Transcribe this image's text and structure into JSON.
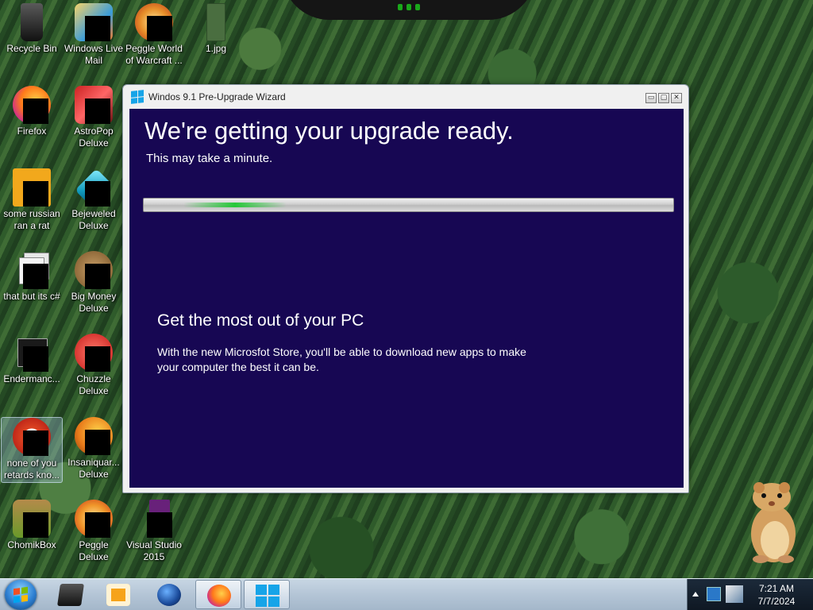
{
  "desktop": {
    "icons": [
      {
        "label": "Recycle Bin",
        "icon": "recycle-bin-icon"
      },
      {
        "label": "Windows Live Mail",
        "icon": "mail-icon"
      },
      {
        "label": "Peggle World of Warcraft ...",
        "icon": "peggle-wow-icon"
      },
      {
        "label": "1.jpg",
        "icon": "image-file-icon"
      },
      {
        "label": "Firefox",
        "icon": "firefox-icon"
      },
      {
        "label": "AstroPop Deluxe",
        "icon": "astropop-icon"
      },
      {
        "label": "some russian ran a rat",
        "icon": "app-icon"
      },
      {
        "label": "Bejeweled Deluxe",
        "icon": "bejeweled-icon"
      },
      {
        "label": "that but its c#",
        "icon": "stacked-windows-icon"
      },
      {
        "label": "Big Money Deluxe",
        "icon": "big-money-icon"
      },
      {
        "label": "Endermanc...",
        "icon": "terminal-icon"
      },
      {
        "label": "Chuzzle Deluxe",
        "icon": "chuzzle-icon"
      },
      {
        "label": "none of you retards kno...",
        "icon": "shortcut-icon"
      },
      {
        "label": "Insaniquar... Deluxe",
        "icon": "insaniquarium-icon"
      },
      {
        "label": "ChomikBox",
        "icon": "chomikbox-icon"
      },
      {
        "label": "Peggle Deluxe",
        "icon": "peggle-icon"
      },
      {
        "label": "Visual Studio 2015",
        "icon": "visual-studio-icon"
      }
    ]
  },
  "window": {
    "title": "Windos 9.1 Pre-Upgrade Wizard",
    "controls": {
      "minimize": "▭",
      "maximize": "▢",
      "close": "✕"
    },
    "headline": "We're getting your upgrade ready.",
    "subline": "This may take a minute.",
    "progress_indeterminate": true,
    "promo_title": "Get the most out of your PC",
    "promo_body": "With the new Microsfot Store, you'll be able to download new apps to make your computer the best it can be."
  },
  "taskbar": {
    "start_icon": "start-orb-icon",
    "pinned": [
      {
        "name": "file-explorer",
        "icon": "folder-icon"
      },
      {
        "name": "media-player",
        "icon": "media-player-icon"
      },
      {
        "name": "internet-explorer",
        "icon": "globe-icon"
      },
      {
        "name": "firefox",
        "icon": "firefox-icon",
        "active": true
      },
      {
        "name": "upgrade-wizard",
        "icon": "windows-logo-icon",
        "active": true
      }
    ],
    "clock": {
      "time": "7:21 AM",
      "date": "7/7/2024"
    }
  },
  "colors": {
    "wizard_background": "#170753",
    "windows_blue": "#16a4e8",
    "progress_green": "#14c828"
  }
}
